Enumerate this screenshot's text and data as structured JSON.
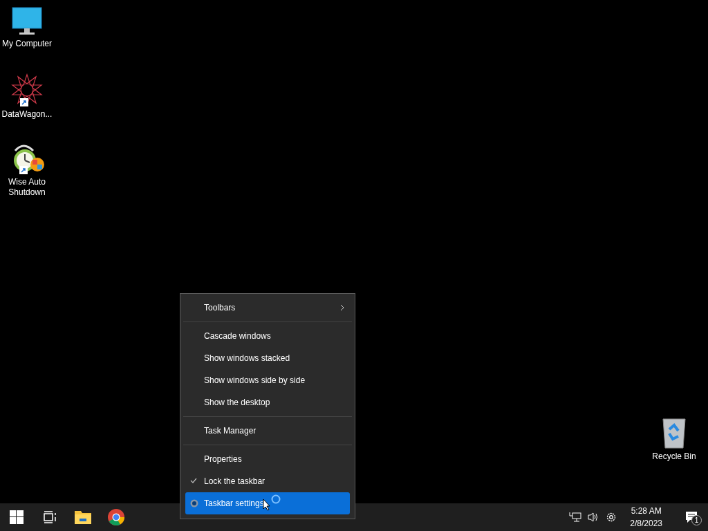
{
  "desktop_icons": [
    {
      "label": "My Computer",
      "kind": "monitor",
      "shortcut": false
    },
    {
      "label": "DataWagon...",
      "kind": "star",
      "shortcut": true
    },
    {
      "label": "Wise Auto Shutdown",
      "kind": "clock",
      "shortcut": true
    },
    {
      "label": "Recycle Bin",
      "kind": "bin",
      "shortcut": false
    }
  ],
  "context_menu": {
    "groups": [
      [
        {
          "label": "Toolbars",
          "kind": "submenu",
          "checked": false,
          "selected": false
        }
      ],
      [
        {
          "label": "Cascade windows",
          "kind": "plain",
          "checked": false,
          "selected": false
        },
        {
          "label": "Show windows stacked",
          "kind": "plain",
          "checked": false,
          "selected": false
        },
        {
          "label": "Show windows side by side",
          "kind": "plain",
          "checked": false,
          "selected": false
        },
        {
          "label": "Show the desktop",
          "kind": "plain",
          "checked": false,
          "selected": false
        }
      ],
      [
        {
          "label": "Task Manager",
          "kind": "plain",
          "checked": false,
          "selected": false
        }
      ],
      [
        {
          "label": "Properties",
          "kind": "plain",
          "checked": false,
          "selected": false
        },
        {
          "label": "Lock the taskbar",
          "kind": "plain",
          "checked": true,
          "selected": false
        },
        {
          "label": "Taskbar settings",
          "kind": "settings",
          "checked": false,
          "selected": true
        }
      ]
    ]
  },
  "taskbar": {
    "apps": [
      {
        "kind": "start"
      },
      {
        "kind": "taskview"
      },
      {
        "kind": "explorer"
      },
      {
        "kind": "chrome"
      }
    ],
    "tray": {
      "time": "5:28 AM",
      "date": "2/8/2023",
      "notification_count": "1"
    }
  }
}
